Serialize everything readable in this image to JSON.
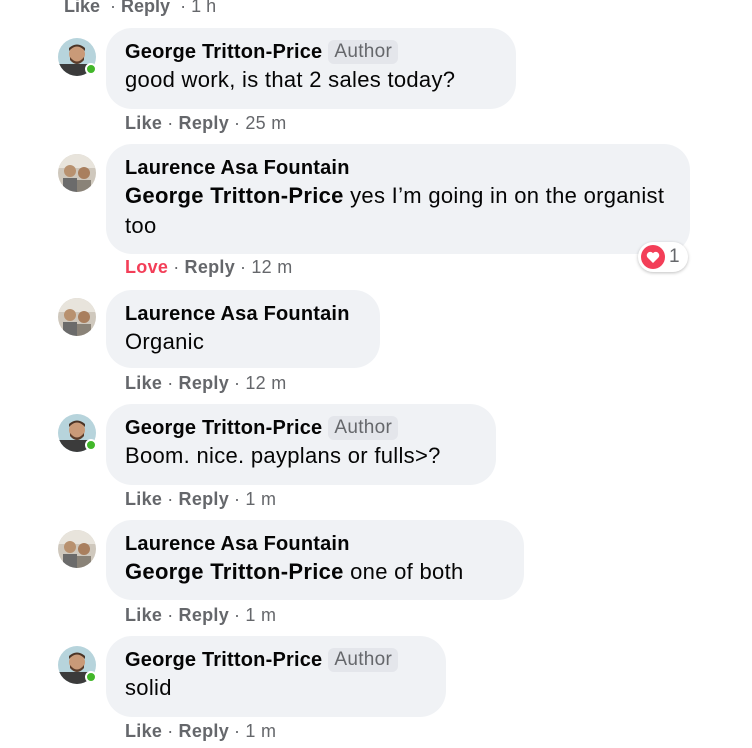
{
  "top_actions": {
    "like": "Like",
    "reply": "Reply",
    "time": "1 h"
  },
  "comments": [
    {
      "author": "George Tritton-Price",
      "badge": "Author",
      "text": "good work, is that 2 sales today?",
      "actions": {
        "like": "Like",
        "reply": "Reply",
        "time": "25 m"
      }
    },
    {
      "author": "Laurence Asa Fountain",
      "mention": "George Tritton-Price",
      "text": " yes I’m going in on the organist too",
      "actions": {
        "like": "Love",
        "reply": "Reply",
        "time": "12 m"
      },
      "reaction_count": "1"
    },
    {
      "author": "Laurence Asa Fountain",
      "text": "Organic",
      "actions": {
        "like": "Like",
        "reply": "Reply",
        "time": "12 m"
      }
    },
    {
      "author": "George Tritton-Price",
      "badge": "Author",
      "text": "Boom. nice. payplans or fulls>?",
      "actions": {
        "like": "Like",
        "reply": "Reply",
        "time": "1 m"
      }
    },
    {
      "author": "Laurence Asa Fountain",
      "mention": "George Tritton-Price",
      "text": " one of both",
      "actions": {
        "like": "Like",
        "reply": "Reply",
        "time": "1 m"
      }
    },
    {
      "author": "George Tritton-Price",
      "badge": "Author",
      "text": "solid",
      "actions": {
        "like": "Like",
        "reply": "Reply",
        "time": "1 m"
      }
    }
  ],
  "colors": {
    "love": "#f33e58",
    "online": "#42b72a",
    "bubble": "#f0f2f5"
  }
}
